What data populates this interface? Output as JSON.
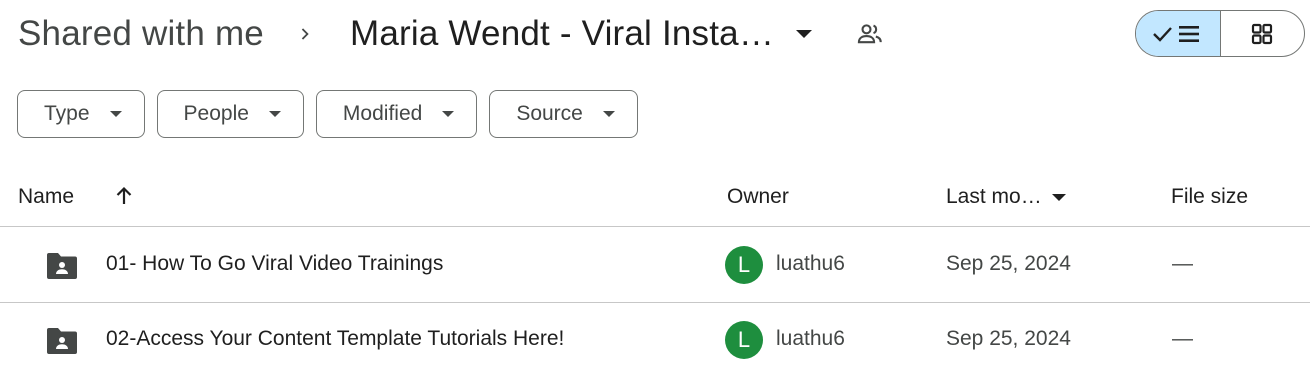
{
  "breadcrumb": {
    "root": "Shared with me",
    "current": "Maria Wendt - Viral Insta…"
  },
  "view_toggle": {
    "list_selected": true,
    "options": [
      "list-view",
      "grid-view"
    ]
  },
  "filters": [
    {
      "label": "Type"
    },
    {
      "label": "People"
    },
    {
      "label": "Modified"
    },
    {
      "label": "Source"
    }
  ],
  "table": {
    "columns": {
      "name": "Name",
      "owner": "Owner",
      "last_modified": "Last mo…",
      "file_size": "File size"
    },
    "sort": "name-ascending",
    "rows": [
      {
        "name": "01- How To Go Viral Video Trainings",
        "owner_initial": "L",
        "owner": "luathu6",
        "date": "Sep 25, 2024",
        "size": "—"
      },
      {
        "name": "02-Access Your Content Template Tutorials Here!",
        "owner_initial": "L",
        "owner": "luathu6",
        "date": "Sep 25, 2024",
        "size": "—"
      }
    ]
  },
  "colors": {
    "avatar": "#1e8e3e",
    "toggle_active": "#c2e7ff"
  }
}
